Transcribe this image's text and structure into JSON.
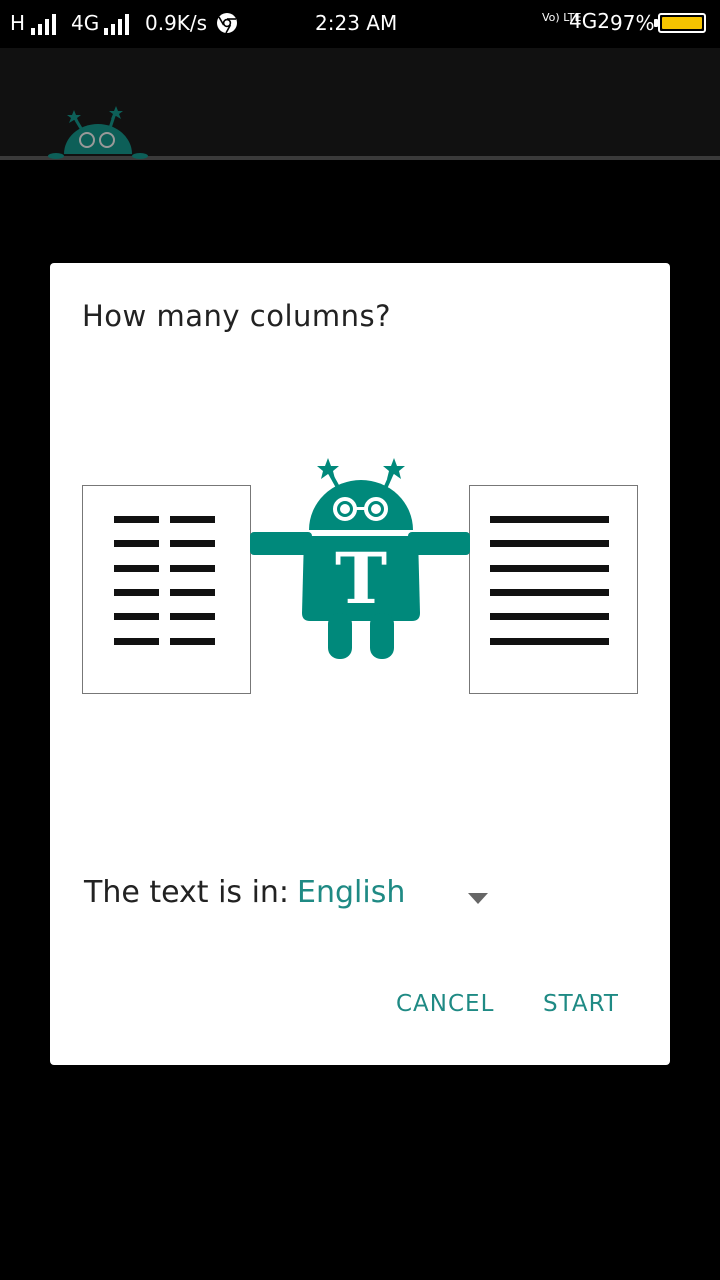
{
  "status_bar": {
    "left_network": "H",
    "second_network": "4G",
    "speed": "0.9K/s",
    "time": "2:23 AM",
    "volte": "Vo) LTE",
    "right_network": "4G2",
    "battery_percent": "97%",
    "battery_color": "#f5c400",
    "icons": [
      "signal-icon",
      "chrome-icon",
      "battery-icon"
    ]
  },
  "dialog": {
    "title": "How many columns?",
    "mascot_letter": "T",
    "language_label": "The text is in:",
    "language_value": "English",
    "cancel_label": "CANCEL",
    "start_label": "START"
  },
  "colors": {
    "accent": "#1f8a84",
    "mascot": "#00897b"
  }
}
